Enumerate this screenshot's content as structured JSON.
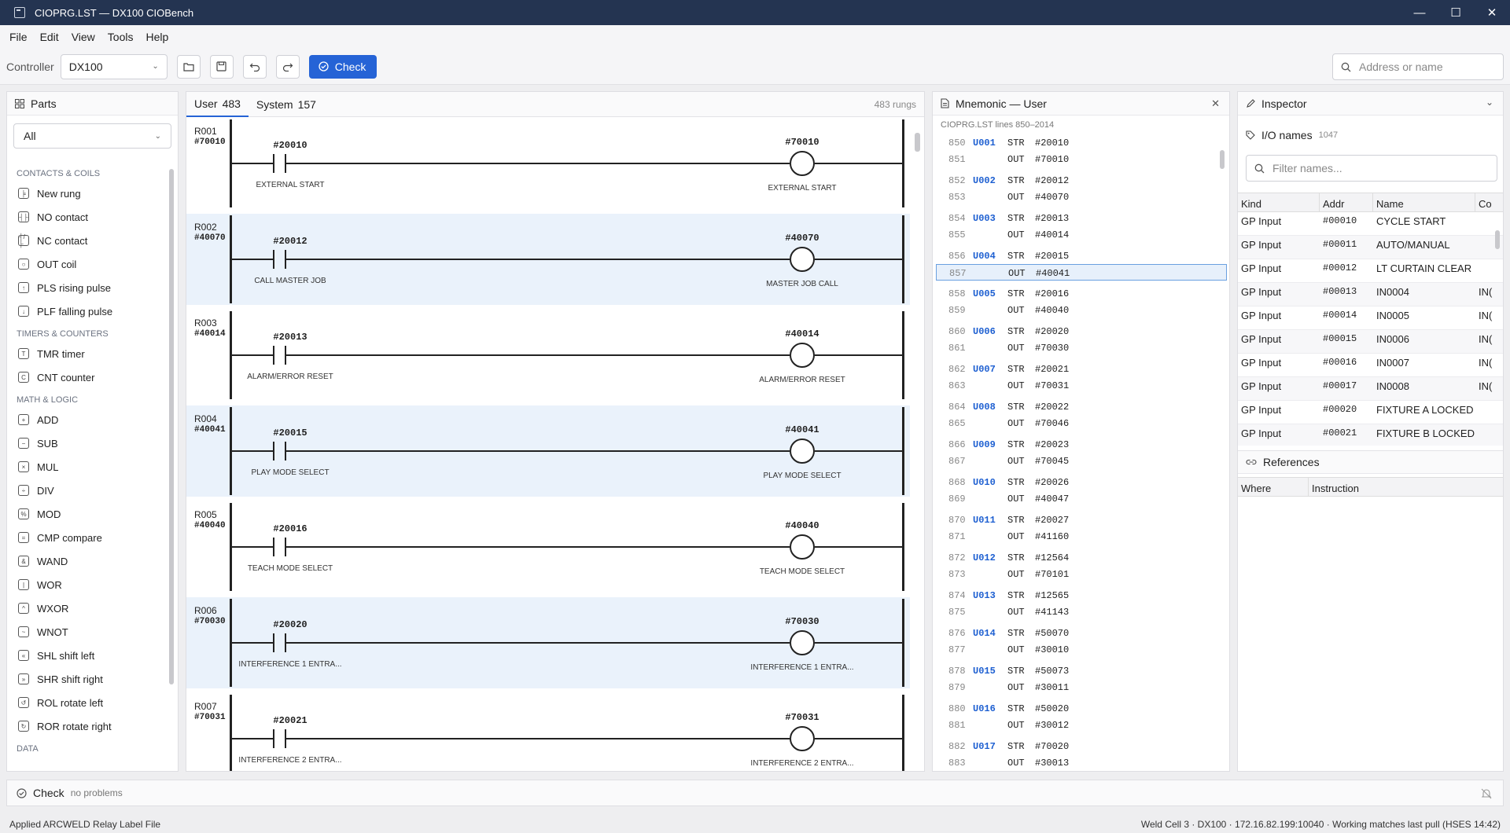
{
  "window": {
    "title": "CIOPRG.LST — DX100 CIOBench",
    "minimize": "—",
    "maximize": "☐",
    "close": "✕"
  },
  "menu": [
    "File",
    "Edit",
    "View",
    "Tools",
    "Help"
  ],
  "toolbar": {
    "controller_label": "Controller",
    "controller_value": "DX100",
    "check_label": "Check",
    "search_placeholder": "Address or name"
  },
  "parts": {
    "title": "Parts",
    "filter": "All",
    "groups": [
      {
        "name": "CONTACTS & COILS",
        "items": [
          {
            "icon": "new-rung-icon",
            "glyph": "╞",
            "label": "New rung"
          },
          {
            "icon": "no-contact-icon",
            "glyph": "┤├",
            "label": "NO contact"
          },
          {
            "icon": "nc-contact-icon",
            "glyph": "┤/├",
            "label": "NC contact"
          },
          {
            "icon": "out-coil-icon",
            "glyph": "○",
            "label": "OUT coil"
          },
          {
            "icon": "pls-icon",
            "glyph": "↑",
            "label": "PLS rising pulse"
          },
          {
            "icon": "plf-icon",
            "glyph": "↓",
            "label": "PLF falling pulse"
          }
        ]
      },
      {
        "name": "TIMERS & COUNTERS",
        "items": [
          {
            "icon": "timer-icon",
            "glyph": "T",
            "label": "TMR timer"
          },
          {
            "icon": "counter-icon",
            "glyph": "C",
            "label": "CNT counter"
          }
        ]
      },
      {
        "name": "MATH & LOGIC",
        "items": [
          {
            "icon": "add-icon",
            "glyph": "+",
            "label": "ADD"
          },
          {
            "icon": "sub-icon",
            "glyph": "−",
            "label": "SUB"
          },
          {
            "icon": "mul-icon",
            "glyph": "×",
            "label": "MUL"
          },
          {
            "icon": "div-icon",
            "glyph": "÷",
            "label": "DIV"
          },
          {
            "icon": "mod-icon",
            "glyph": "%",
            "label": "MOD"
          },
          {
            "icon": "cmp-icon",
            "glyph": "=",
            "label": "CMP compare"
          },
          {
            "icon": "wand-icon",
            "glyph": "&",
            "label": "WAND"
          },
          {
            "icon": "wor-icon",
            "glyph": "|",
            "label": "WOR"
          },
          {
            "icon": "wxor-icon",
            "glyph": "^",
            "label": "WXOR"
          },
          {
            "icon": "wnot-icon",
            "glyph": "~",
            "label": "WNOT"
          },
          {
            "icon": "shl-icon",
            "glyph": "«",
            "label": "SHL shift left"
          },
          {
            "icon": "shr-icon",
            "glyph": "»",
            "label": "SHR shift right"
          },
          {
            "icon": "rol-icon",
            "glyph": "↺",
            "label": "ROL rotate left"
          },
          {
            "icon": "ror-icon",
            "glyph": "↻",
            "label": "ROR rotate right"
          }
        ]
      },
      {
        "name": "DATA",
        "items": []
      }
    ]
  },
  "ladder": {
    "tabs": [
      {
        "label": "User",
        "count": "483"
      },
      {
        "label": "System",
        "count": "157"
      }
    ],
    "total": "483 rungs",
    "rungs": [
      {
        "label": "R001",
        "addr": "#70010",
        "contact": "#20010",
        "contact_name": "EXTERNAL START",
        "coil": "#70010",
        "coil_name": "EXTERNAL START"
      },
      {
        "label": "R002",
        "addr": "#40070",
        "contact": "#20012",
        "contact_name": "CALL MASTER JOB",
        "coil": "#40070",
        "coil_name": "MASTER JOB CALL"
      },
      {
        "label": "R003",
        "addr": "#40014",
        "contact": "#20013",
        "contact_name": "ALARM/ERROR RESET",
        "coil": "#40014",
        "coil_name": "ALARM/ERROR RESET"
      },
      {
        "label": "R004",
        "addr": "#40041",
        "contact": "#20015",
        "contact_name": "PLAY MODE SELECT",
        "coil": "#40041",
        "coil_name": "PLAY MODE SELECT"
      },
      {
        "label": "R005",
        "addr": "#40040",
        "contact": "#20016",
        "contact_name": "TEACH MODE SELECT",
        "coil": "#40040",
        "coil_name": "TEACH MODE SELECT"
      },
      {
        "label": "R006",
        "addr": "#70030",
        "contact": "#20020",
        "contact_name": "INTERFERENCE 1 ENTRA...",
        "coil": "#70030",
        "coil_name": "INTERFERENCE 1 ENTRA..."
      },
      {
        "label": "R007",
        "addr": "#70031",
        "contact": "#20021",
        "contact_name": "INTERFERENCE 2 ENTRA...",
        "coil": "#70031",
        "coil_name": "INTERFERENCE 2 ENTRA..."
      }
    ]
  },
  "mnemonic": {
    "title": "Mnemonic — User",
    "subtitle": "CIOPRG.LST lines 850–2014",
    "selected_line": "857",
    "rows": [
      {
        "ln": "850",
        "lbl": "U001",
        "op": "STR",
        "arg": "#20010"
      },
      {
        "ln": "851",
        "lbl": "",
        "op": "OUT",
        "arg": "#70010"
      },
      {
        "ln": "852",
        "lbl": "U002",
        "op": "STR",
        "arg": "#20012"
      },
      {
        "ln": "853",
        "lbl": "",
        "op": "OUT",
        "arg": "#40070"
      },
      {
        "ln": "854",
        "lbl": "U003",
        "op": "STR",
        "arg": "#20013"
      },
      {
        "ln": "855",
        "lbl": "",
        "op": "OUT",
        "arg": "#40014"
      },
      {
        "ln": "856",
        "lbl": "U004",
        "op": "STR",
        "arg": "#20015"
      },
      {
        "ln": "857",
        "lbl": "",
        "op": "OUT",
        "arg": "#40041"
      },
      {
        "ln": "858",
        "lbl": "U005",
        "op": "STR",
        "arg": "#20016"
      },
      {
        "ln": "859",
        "lbl": "",
        "op": "OUT",
        "arg": "#40040"
      },
      {
        "ln": "860",
        "lbl": "U006",
        "op": "STR",
        "arg": "#20020"
      },
      {
        "ln": "861",
        "lbl": "",
        "op": "OUT",
        "arg": "#70030"
      },
      {
        "ln": "862",
        "lbl": "U007",
        "op": "STR",
        "arg": "#20021"
      },
      {
        "ln": "863",
        "lbl": "",
        "op": "OUT",
        "arg": "#70031"
      },
      {
        "ln": "864",
        "lbl": "U008",
        "op": "STR",
        "arg": "#20022"
      },
      {
        "ln": "865",
        "lbl": "",
        "op": "OUT",
        "arg": "#70046"
      },
      {
        "ln": "866",
        "lbl": "U009",
        "op": "STR",
        "arg": "#20023"
      },
      {
        "ln": "867",
        "lbl": "",
        "op": "OUT",
        "arg": "#70045"
      },
      {
        "ln": "868",
        "lbl": "U010",
        "op": "STR",
        "arg": "#20026"
      },
      {
        "ln": "869",
        "lbl": "",
        "op": "OUT",
        "arg": "#40047"
      },
      {
        "ln": "870",
        "lbl": "U011",
        "op": "STR",
        "arg": "#20027"
      },
      {
        "ln": "871",
        "lbl": "",
        "op": "OUT",
        "arg": "#41160"
      },
      {
        "ln": "872",
        "lbl": "U012",
        "op": "STR",
        "arg": "#12564"
      },
      {
        "ln": "873",
        "lbl": "",
        "op": "OUT",
        "arg": "#70101"
      },
      {
        "ln": "874",
        "lbl": "U013",
        "op": "STR",
        "arg": "#12565"
      },
      {
        "ln": "875",
        "lbl": "",
        "op": "OUT",
        "arg": "#41143"
      },
      {
        "ln": "876",
        "lbl": "U014",
        "op": "STR",
        "arg": "#50070"
      },
      {
        "ln": "877",
        "lbl": "",
        "op": "OUT",
        "arg": "#30010"
      },
      {
        "ln": "878",
        "lbl": "U015",
        "op": "STR",
        "arg": "#50073"
      },
      {
        "ln": "879",
        "lbl": "",
        "op": "OUT",
        "arg": "#30011"
      },
      {
        "ln": "880",
        "lbl": "U016",
        "op": "STR",
        "arg": "#50020"
      },
      {
        "ln": "881",
        "lbl": "",
        "op": "OUT",
        "arg": "#30012"
      },
      {
        "ln": "882",
        "lbl": "U017",
        "op": "STR",
        "arg": "#70020"
      },
      {
        "ln": "883",
        "lbl": "",
        "op": "OUT",
        "arg": "#30013"
      }
    ]
  },
  "inspector": {
    "title": "Inspector",
    "io_title": "I/O names",
    "io_count": "1047",
    "filter_placeholder": "Filter names...",
    "columns": [
      "Kind",
      "Addr",
      "Name",
      "Co"
    ],
    "rows": [
      {
        "kind": "GP Input",
        "addr": "#00010",
        "name": "CYCLE START",
        "extra": ""
      },
      {
        "kind": "GP Input",
        "addr": "#00011",
        "name": "AUTO/MANUAL",
        "extra": ""
      },
      {
        "kind": "GP Input",
        "addr": "#00012",
        "name": "LT CURTAIN CLEAR",
        "extra": ""
      },
      {
        "kind": "GP Input",
        "addr": "#00013",
        "name": "IN0004",
        "extra": "IN("
      },
      {
        "kind": "GP Input",
        "addr": "#00014",
        "name": "IN0005",
        "extra": "IN("
      },
      {
        "kind": "GP Input",
        "addr": "#00015",
        "name": "IN0006",
        "extra": "IN("
      },
      {
        "kind": "GP Input",
        "addr": "#00016",
        "name": "IN0007",
        "extra": "IN("
      },
      {
        "kind": "GP Input",
        "addr": "#00017",
        "name": "IN0008",
        "extra": "IN("
      },
      {
        "kind": "GP Input",
        "addr": "#00020",
        "name": "FIXTURE A LOCKED",
        "extra": ""
      },
      {
        "kind": "GP Input",
        "addr": "#00021",
        "name": "FIXTURE B LOCKED",
        "extra": ""
      }
    ],
    "refs_title": "References",
    "refs_columns": [
      "Where",
      "Instruction"
    ]
  },
  "check": {
    "label": "Check",
    "status": "no problems"
  },
  "status": {
    "left": "Applied ARCWELD Relay Label File",
    "right": "Weld Cell 3 · DX100 · 172.16.82.199:10040 · Working matches last pull (HSES 14:42)"
  },
  "colors": {
    "accent": "#2563d6",
    "titlebar": "#243451",
    "label_blue": "#1d5fd1",
    "rung_alt": "#eaf2fb"
  }
}
